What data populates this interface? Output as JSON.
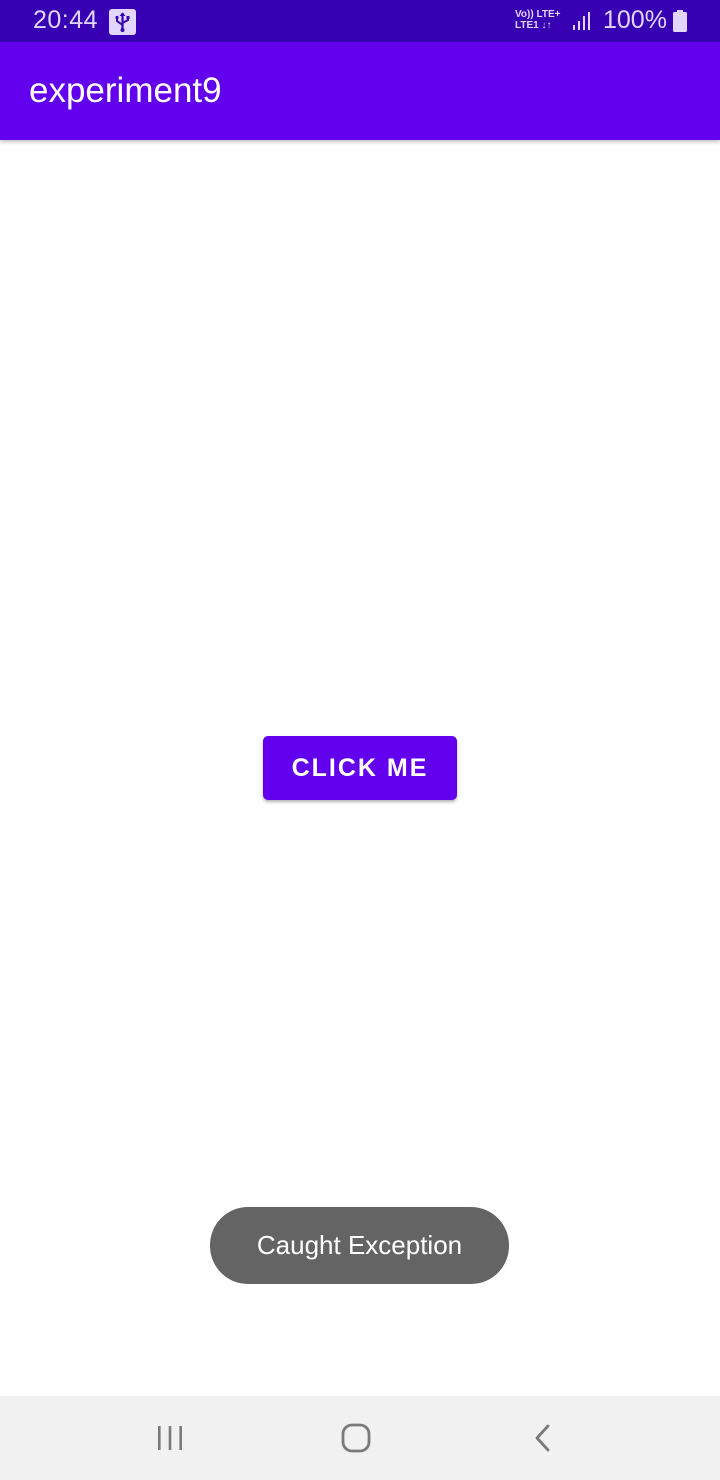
{
  "status_bar": {
    "time": "20:44",
    "network_top": "Vo)) LTE+",
    "network_bottom": "LTE1 ↓↑",
    "battery": "100%",
    "icons": [
      "usb-icon",
      "signal-icon",
      "battery-icon"
    ]
  },
  "app_bar": {
    "title": "experiment9"
  },
  "main": {
    "button_label": "CLICK ME"
  },
  "toast": {
    "message": "Caught Exception"
  },
  "nav_bar": {
    "icons": [
      "recents-icon",
      "home-icon",
      "back-icon"
    ]
  },
  "colors": {
    "primary": "#6200ee",
    "primary_dark": "#3700b3",
    "toast_bg": "#646464",
    "nav_bg": "#f1f1f1"
  }
}
